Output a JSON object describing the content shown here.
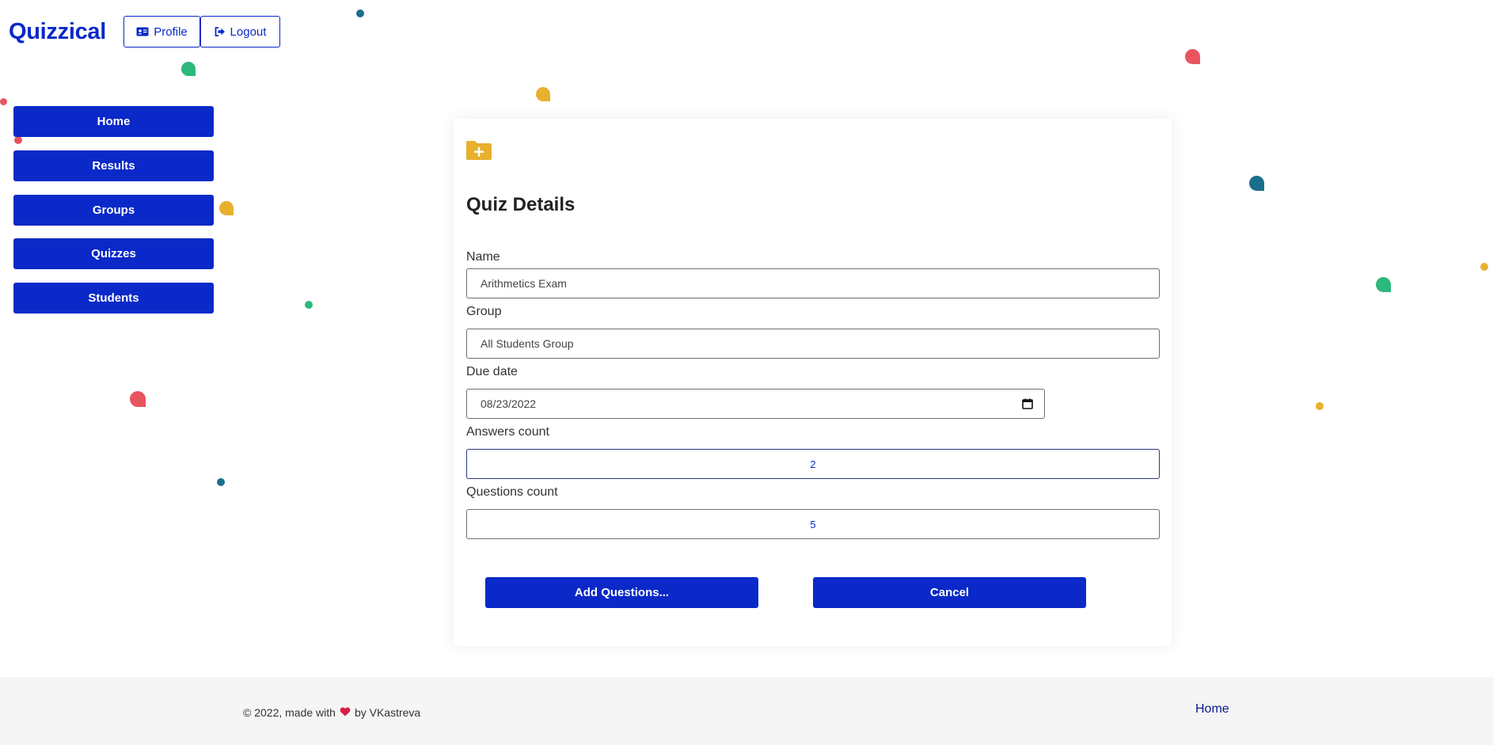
{
  "app": {
    "brand": "Quizzical"
  },
  "header": {
    "profile_label": "Profile",
    "logout_label": "Logout"
  },
  "sidebar": {
    "items": [
      {
        "label": "Home"
      },
      {
        "label": "Results"
      },
      {
        "label": "Groups"
      },
      {
        "label": "Quizzes"
      },
      {
        "label": "Students"
      }
    ]
  },
  "form": {
    "title": "Quiz Details",
    "name_label": "Name",
    "name_value": "Arithmetics Exam",
    "group_label": "Group",
    "group_value": "All Students Group",
    "due_label": "Due date",
    "due_value": "08/23/2022",
    "answers_label": "Answers count",
    "answers_value": "2",
    "questions_label": "Questions count",
    "questions_value": "5",
    "add_questions_label": "Add Questions...",
    "cancel_label": "Cancel"
  },
  "footer": {
    "copyright_prefix": "© 2022, made with",
    "copyright_suffix": "by VKastreva",
    "home_link": "Home"
  },
  "colors": {
    "primary": "#0a29c8",
    "accent_yellow": "#e8b02c",
    "heart": "#d81b47",
    "confetti_red": "#e8555f",
    "confetti_green": "#2db87c",
    "confetti_teal": "#1a6e8e"
  },
  "icons": {
    "profile": "id-card-icon",
    "logout": "sign-out-icon",
    "folder": "folder-plus-icon",
    "calendar": "calendar-icon",
    "heart": "heart-icon"
  }
}
